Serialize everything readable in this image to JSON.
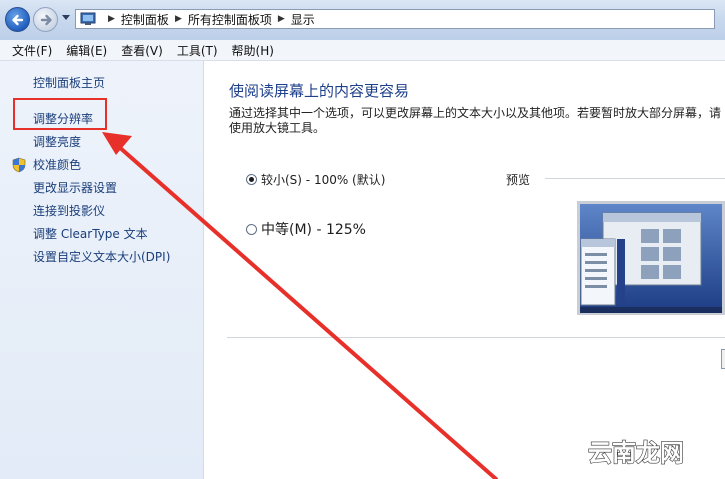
{
  "address": {
    "crumbs": [
      "控制面板",
      "所有控制面板项",
      "显示"
    ]
  },
  "menu": {
    "items": [
      "文件(F)",
      "编辑(E)",
      "查看(V)",
      "工具(T)",
      "帮助(H)"
    ]
  },
  "sidebar": {
    "home": "控制面板主页",
    "items": [
      "调整分辨率",
      "调整亮度",
      "校准颜色",
      "更改显示器设置",
      "连接到投影仪",
      "调整 ClearType 文本",
      "设置自定义文本大小(DPI)"
    ]
  },
  "main": {
    "title": "使阅读屏幕上的内容更容易",
    "description": "通过选择其中一个选项，可以更改屏幕上的文本大小以及其他项。若要暂时放大部分屏幕，请使用放大镜工具。",
    "options": [
      {
        "label": "较小(S) - 100% (默认)",
        "selected": true
      },
      {
        "label": "中等(M) - 125%",
        "selected": false
      }
    ],
    "preview_label": "预览"
  },
  "colors": {
    "link": "#1a3e7a",
    "title": "#1e3f8a",
    "annotation": "#e8302a"
  },
  "watermark": {
    "text": "云南龙网"
  }
}
